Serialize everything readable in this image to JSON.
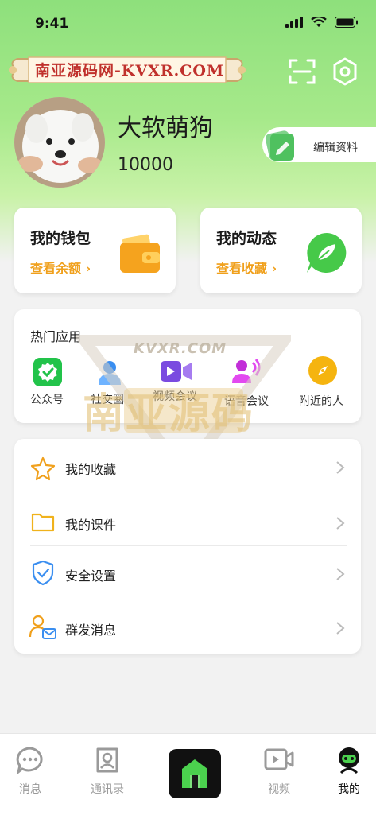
{
  "status_bar": {
    "time": "9:41"
  },
  "watermark": {
    "text": "南亚源码网-KVXR.COM",
    "overlay_text": "KVXR.COM",
    "overlay_big": "南亚源码"
  },
  "profile": {
    "name": "大软萌狗",
    "id": "10000",
    "edit_label": "编辑资料"
  },
  "wallet_card": {
    "title": "我的钱包",
    "link": "查看余额 ›"
  },
  "moments_card": {
    "title": "我的动态",
    "link": "查看收藏 ›"
  },
  "apps": {
    "title": "热门应用",
    "items": [
      {
        "label": "公众号",
        "icon": "official-account-icon"
      },
      {
        "label": "社交圈",
        "icon": "social-circle-icon"
      },
      {
        "label": "视频会议",
        "icon": "video-meeting-icon"
      },
      {
        "label": "语音会议",
        "icon": "voice-meeting-icon"
      },
      {
        "label": "附近的人",
        "icon": "nearby-icon"
      }
    ]
  },
  "menu": [
    {
      "label": "我的收藏",
      "icon": "star-icon"
    },
    {
      "label": "我的课件",
      "icon": "folder-icon"
    },
    {
      "label": "安全设置",
      "icon": "shield-icon"
    },
    {
      "label": "群发消息",
      "icon": "broadcast-message-icon"
    }
  ],
  "bottom_nav": {
    "messages": "消息",
    "contacts": "通讯录",
    "video": "视频",
    "me": "我的"
  },
  "colors": {
    "accent": "#f0a01c",
    "green": "#5cc85a",
    "hero": "#9be582"
  }
}
